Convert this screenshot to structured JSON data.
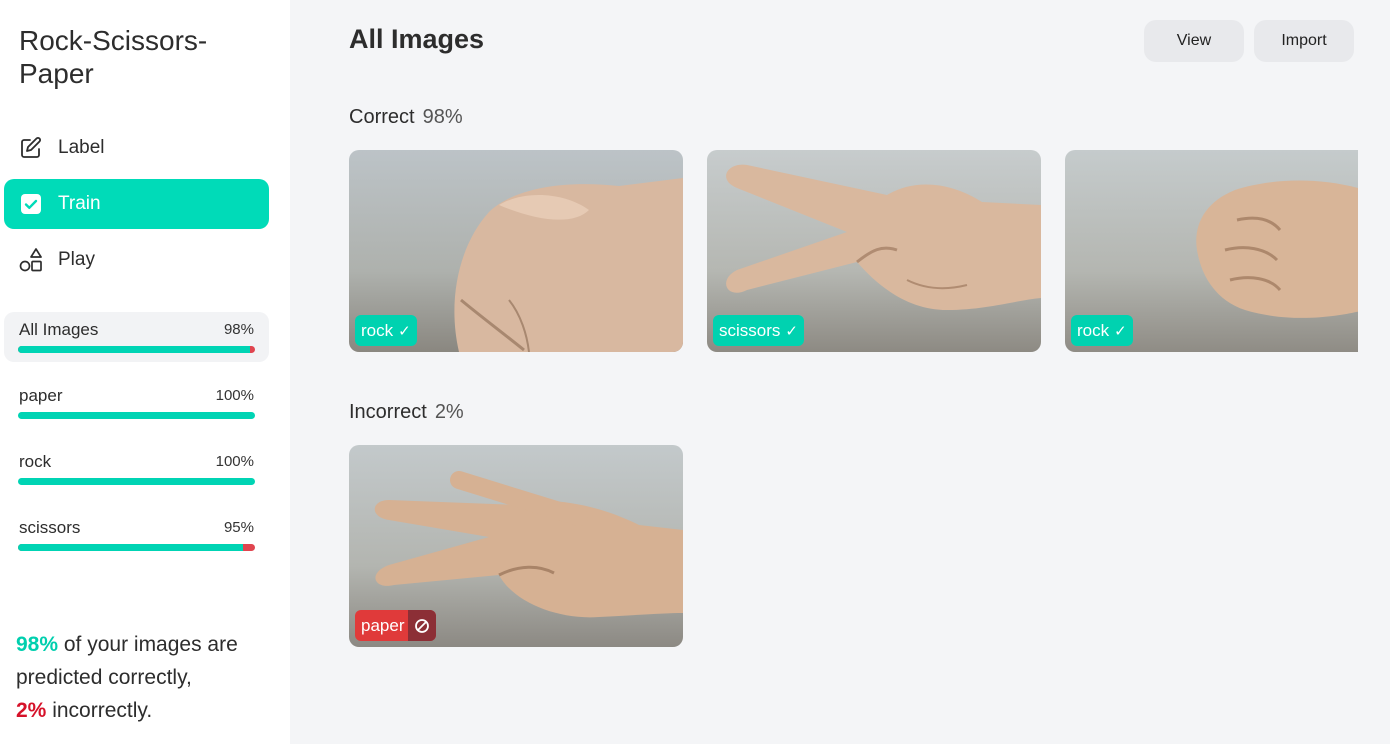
{
  "app": {
    "title": "Rock-Scissors-Paper"
  },
  "nav": {
    "items": [
      {
        "label": "Label",
        "icon": "edit-icon"
      },
      {
        "label": "Train",
        "icon": "checkbox-icon",
        "active": true
      },
      {
        "label": "Play",
        "icon": "shapes-icon"
      }
    ]
  },
  "classes": [
    {
      "name": "All Images",
      "percent": "98%",
      "accuracy": 0.98,
      "selected": true
    },
    {
      "name": "paper",
      "percent": "100%",
      "accuracy": 1.0
    },
    {
      "name": "rock",
      "percent": "100%",
      "accuracy": 1.0
    },
    {
      "name": "scissors",
      "percent": "95%",
      "accuracy": 0.95
    }
  ],
  "summary": {
    "correct_pct": "98%",
    "correct_text": " of your images are predicted correctly,",
    "incorrect_pct": "2%",
    "incorrect_text": " incorrectly."
  },
  "main": {
    "title": "All Images",
    "view_label": "View",
    "import_label": "Import",
    "correct": {
      "label": "Correct",
      "percent": "98%",
      "images": [
        {
          "prediction": "rock",
          "status": "correct"
        },
        {
          "prediction": "scissors",
          "status": "correct"
        },
        {
          "prediction": "rock",
          "status": "correct"
        }
      ]
    },
    "incorrect": {
      "label": "Incorrect",
      "percent": "2%",
      "images": [
        {
          "prediction": "paper",
          "status": "incorrect"
        }
      ]
    }
  },
  "colors": {
    "accent": "#00dbb8",
    "error": "#d6122a"
  }
}
